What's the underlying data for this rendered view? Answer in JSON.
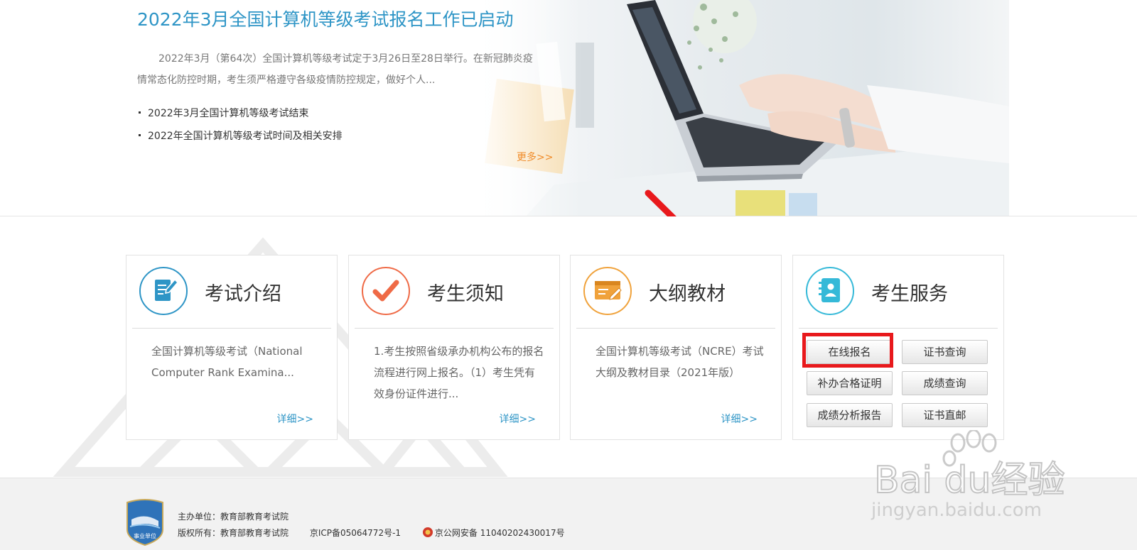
{
  "hero": {
    "title": "2022年3月全国计算机等级考试报名工作已启动",
    "description": "2022年3月（第64次）全国计算机等级考试定于3月26日至28日举行。在新冠肺炎疫情常态化防控时期，考生须严格遵守各级疫情防控规定，做好个人...",
    "news": [
      "2022年3月全国计算机等级考试结束",
      "2022年全国计算机等级考试时间及相关安排"
    ],
    "more_label": "更多>>"
  },
  "cards": [
    {
      "title": "考试介绍",
      "icon": "document-pen-icon",
      "color": "#2e95c6",
      "body": "全国计算机等级考试（National Computer Rank Examina...",
      "more": "详细>>"
    },
    {
      "title": "考生须知",
      "icon": "checkmark-icon",
      "color": "#ef6a46",
      "body": "1.考生按照省级承办机构公布的报名流程进行网上报名。（1）考生凭有效身份证件进行...",
      "more": "详细>>"
    },
    {
      "title": "大纲教材",
      "icon": "syllabus-board-icon",
      "color": "#f0a23b",
      "body": "全国计算机等级考试（NCRE）考试大纲及教材目录（2021年版）",
      "more": "详细>>"
    },
    {
      "title": "考生服务",
      "icon": "contacts-book-icon",
      "color": "#35b9d8",
      "buttons": [
        "在线报名",
        "证书查询",
        "补办合格证明",
        "成绩查询",
        "成绩分析报告",
        "证书直邮"
      ]
    }
  ],
  "footer": {
    "host": "主办单位：教育部教育考试院",
    "copyright": "版权所有：教育部教育考试院",
    "icp": "京ICP备05064772号-1",
    "police": "京公网安备 11040202430017号",
    "logo_label": "事业单位"
  },
  "watermark": {
    "brand": "Bai du经验",
    "url": "jingyan.baidu.com"
  },
  "colors": {
    "accent": "#2e95c6",
    "highlight": "#e8191c",
    "more": "#f08c2a"
  }
}
